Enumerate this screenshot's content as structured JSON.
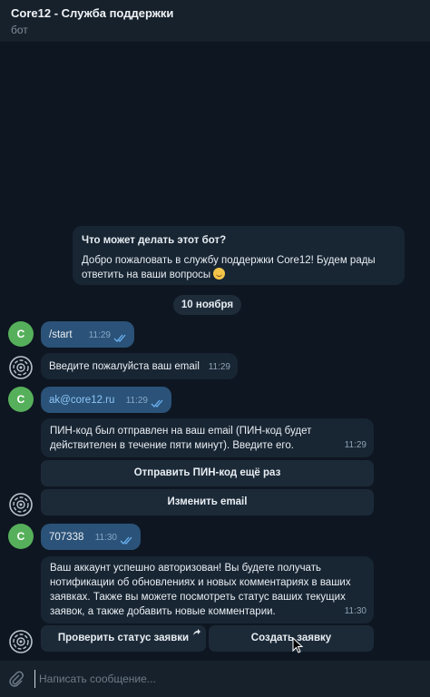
{
  "header": {
    "title": "Core12 - Служба поддержки",
    "subtitle": "бот"
  },
  "intro": {
    "question": "Что может делать этот бот?",
    "text": "Добро пожаловать в службу поддержки Core12! Будем рады ответить на ваши вопросы"
  },
  "date_divider": "10 ноября",
  "avatar_user_letter": "C",
  "messages": [
    {
      "from": "user",
      "text": "/start",
      "time": "11:29"
    },
    {
      "from": "bot",
      "text": "Введите пожалуйста ваш email",
      "time": "11:29"
    },
    {
      "from": "user",
      "text": "ak@core12.ru",
      "time": "11:29"
    },
    {
      "from": "bot",
      "text": "ПИН-код был отправлен на ваш email (ПИН-код будет действителен в течение пяти минут). Введите его.",
      "time": "11:29"
    },
    {
      "from": "user",
      "text": "707338",
      "time": "11:30"
    },
    {
      "from": "bot",
      "text": "Ваш аккаунт успешно авторизован! Вы будете получать нотификации об обновлениях и новых комментариях в ваших заявках. Также вы можете посмотреть статус ваших текущих заявок, а также добавить новые комментарии.",
      "time": "11:30"
    }
  ],
  "keyboard_pin": {
    "resend": "Отправить ПИН-код ещё раз",
    "change_email": "Изменить email"
  },
  "keyboard_main": {
    "check_status": "Проверить статус заявки",
    "create_ticket": "Создать заявку"
  },
  "composer": {
    "placeholder": "Написать сообщение..."
  },
  "colors": {
    "background": "#0e1621",
    "header": "#17212b",
    "outgoing_bubble": "#2b5278",
    "incoming_bubble": "#182533",
    "link": "#8cc6f7",
    "user_avatar": "#56b05b"
  },
  "icons": [
    "bot-avatar-icon",
    "double-check-icon",
    "forward-arrow-icon",
    "paperclip-icon",
    "mouse-cursor-icon",
    "smile-emoji-icon"
  ]
}
